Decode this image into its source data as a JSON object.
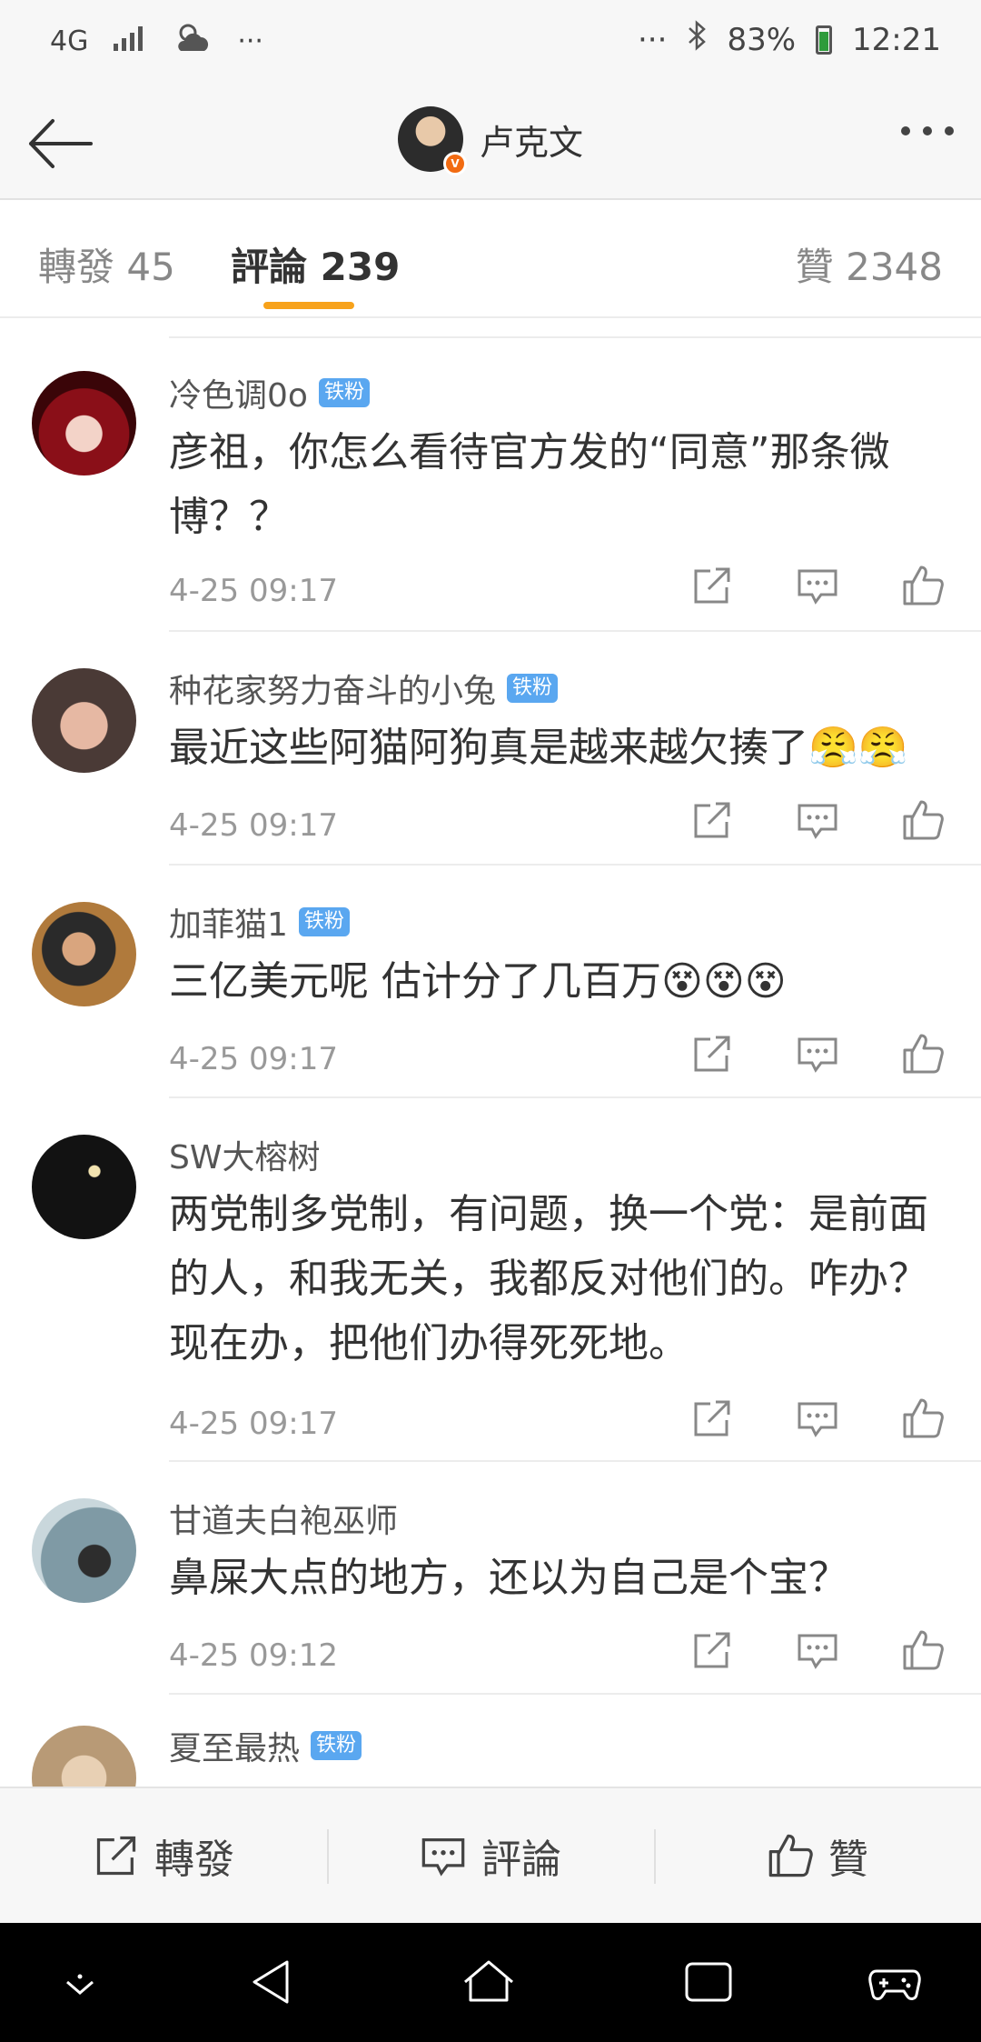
{
  "status_bar": {
    "network": "4G",
    "dots": "···",
    "dots_right": "···",
    "battery": "83%",
    "time": "12:21"
  },
  "nav": {
    "username": "卢克文",
    "verified_badge": "V"
  },
  "tabs": {
    "repost": "轉發 45",
    "comments": "評論 239",
    "likes": "贊 2348"
  },
  "comments": [
    {
      "name": "冷色调0o",
      "badge": "铁粉",
      "text": "彦祖，你怎么看待官方发的“同意”那条微博？？",
      "time": "4-25 09:17"
    },
    {
      "name": "种花家努力奋斗的小兔",
      "badge": "铁粉",
      "text": "最近这些阿猫阿狗真是越来越欠揍了😤😤",
      "time": "4-25 09:17"
    },
    {
      "name": "加菲猫1",
      "badge": "铁粉",
      "text": "三亿美元呢 估计分了几百万😵😵😵",
      "time": "4-25 09:17"
    },
    {
      "name": "SW大榕树",
      "badge": "",
      "text": "两党制多党制，有问题，换一个党：是前面的人，和我无关，我都反对他们的。咋办？现在办，把他们办得死死地。",
      "time": "4-25 09:17"
    },
    {
      "name": "甘道夫白袍巫师",
      "badge": "",
      "text": "鼻屎大点的地方，还以为自己是个宝？",
      "time": "4-25 09:12"
    },
    {
      "name": "夏至最热",
      "badge": "铁粉",
      "text": "",
      "time": ""
    }
  ],
  "bottom_bar": {
    "repost": "轉發",
    "comment": "評論",
    "like": "贊"
  },
  "icons": {
    "accent": "#f7a21b",
    "badge_color": "#5aa7f0",
    "verified_color": "#f26b12"
  }
}
